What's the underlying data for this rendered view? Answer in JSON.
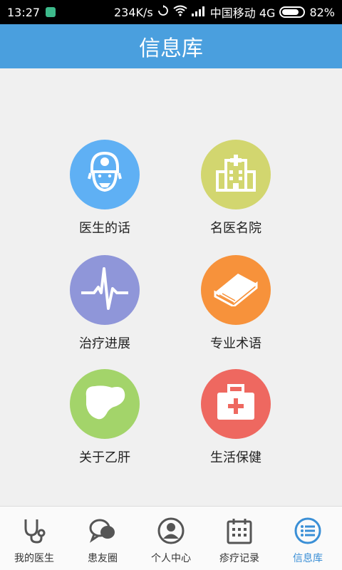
{
  "status_bar": {
    "time": "13:27",
    "speed": "234K/s",
    "carrier": "中国移动 4G",
    "battery": "82%",
    "battery_level": 0.82
  },
  "header": {
    "title": "信息库"
  },
  "grid": {
    "items": [
      {
        "label": "医生的话",
        "icon": "doctor-icon",
        "color": "#5fb0f4"
      },
      {
        "label": "名医名院",
        "icon": "hospital-icon",
        "color": "#d2d66f"
      },
      {
        "label": "治疗进展",
        "icon": "heartbeat-icon",
        "color": "#8f96d9"
      },
      {
        "label": "专业术语",
        "icon": "book-icon",
        "color": "#f7923b"
      },
      {
        "label": "关于乙肝",
        "icon": "liver-icon",
        "color": "#a3d46a"
      },
      {
        "label": "生活保健",
        "icon": "first-aid-kit-icon",
        "color": "#ee6860"
      }
    ]
  },
  "tabbar": {
    "tabs": [
      {
        "label": "我的医生",
        "icon": "stethoscope-icon"
      },
      {
        "label": "患友圈",
        "icon": "chat-bubbles-icon"
      },
      {
        "label": "个人中心",
        "icon": "user-icon"
      },
      {
        "label": "疹疗记录",
        "icon": "calendar-icon"
      },
      {
        "label": "信息库",
        "icon": "list-icon",
        "active": true
      }
    ]
  }
}
